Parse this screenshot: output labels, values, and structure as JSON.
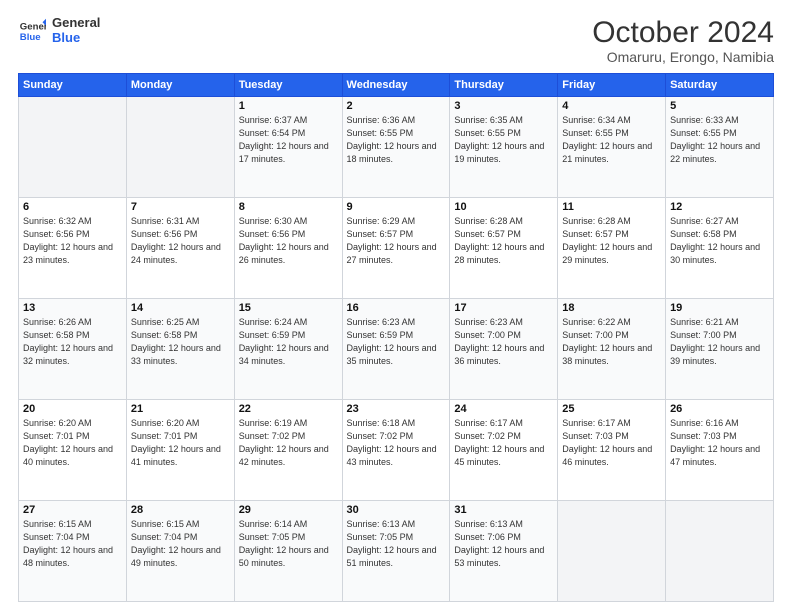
{
  "logo": {
    "line1": "General",
    "line2": "Blue"
  },
  "title": "October 2024",
  "subtitle": "Omaruru, Erongo, Namibia",
  "header_days": [
    "Sunday",
    "Monday",
    "Tuesday",
    "Wednesday",
    "Thursday",
    "Friday",
    "Saturday"
  ],
  "weeks": [
    [
      {
        "day": "",
        "sunrise": "",
        "sunset": "",
        "daylight": ""
      },
      {
        "day": "",
        "sunrise": "",
        "sunset": "",
        "daylight": ""
      },
      {
        "day": "1",
        "sunrise": "Sunrise: 6:37 AM",
        "sunset": "Sunset: 6:54 PM",
        "daylight": "Daylight: 12 hours and 17 minutes."
      },
      {
        "day": "2",
        "sunrise": "Sunrise: 6:36 AM",
        "sunset": "Sunset: 6:55 PM",
        "daylight": "Daylight: 12 hours and 18 minutes."
      },
      {
        "day": "3",
        "sunrise": "Sunrise: 6:35 AM",
        "sunset": "Sunset: 6:55 PM",
        "daylight": "Daylight: 12 hours and 19 minutes."
      },
      {
        "day": "4",
        "sunrise": "Sunrise: 6:34 AM",
        "sunset": "Sunset: 6:55 PM",
        "daylight": "Daylight: 12 hours and 21 minutes."
      },
      {
        "day": "5",
        "sunrise": "Sunrise: 6:33 AM",
        "sunset": "Sunset: 6:55 PM",
        "daylight": "Daylight: 12 hours and 22 minutes."
      }
    ],
    [
      {
        "day": "6",
        "sunrise": "Sunrise: 6:32 AM",
        "sunset": "Sunset: 6:56 PM",
        "daylight": "Daylight: 12 hours and 23 minutes."
      },
      {
        "day": "7",
        "sunrise": "Sunrise: 6:31 AM",
        "sunset": "Sunset: 6:56 PM",
        "daylight": "Daylight: 12 hours and 24 minutes."
      },
      {
        "day": "8",
        "sunrise": "Sunrise: 6:30 AM",
        "sunset": "Sunset: 6:56 PM",
        "daylight": "Daylight: 12 hours and 26 minutes."
      },
      {
        "day": "9",
        "sunrise": "Sunrise: 6:29 AM",
        "sunset": "Sunset: 6:57 PM",
        "daylight": "Daylight: 12 hours and 27 minutes."
      },
      {
        "day": "10",
        "sunrise": "Sunrise: 6:28 AM",
        "sunset": "Sunset: 6:57 PM",
        "daylight": "Daylight: 12 hours and 28 minutes."
      },
      {
        "day": "11",
        "sunrise": "Sunrise: 6:28 AM",
        "sunset": "Sunset: 6:57 PM",
        "daylight": "Daylight: 12 hours and 29 minutes."
      },
      {
        "day": "12",
        "sunrise": "Sunrise: 6:27 AM",
        "sunset": "Sunset: 6:58 PM",
        "daylight": "Daylight: 12 hours and 30 minutes."
      }
    ],
    [
      {
        "day": "13",
        "sunrise": "Sunrise: 6:26 AM",
        "sunset": "Sunset: 6:58 PM",
        "daylight": "Daylight: 12 hours and 32 minutes."
      },
      {
        "day": "14",
        "sunrise": "Sunrise: 6:25 AM",
        "sunset": "Sunset: 6:58 PM",
        "daylight": "Daylight: 12 hours and 33 minutes."
      },
      {
        "day": "15",
        "sunrise": "Sunrise: 6:24 AM",
        "sunset": "Sunset: 6:59 PM",
        "daylight": "Daylight: 12 hours and 34 minutes."
      },
      {
        "day": "16",
        "sunrise": "Sunrise: 6:23 AM",
        "sunset": "Sunset: 6:59 PM",
        "daylight": "Daylight: 12 hours and 35 minutes."
      },
      {
        "day": "17",
        "sunrise": "Sunrise: 6:23 AM",
        "sunset": "Sunset: 7:00 PM",
        "daylight": "Daylight: 12 hours and 36 minutes."
      },
      {
        "day": "18",
        "sunrise": "Sunrise: 6:22 AM",
        "sunset": "Sunset: 7:00 PM",
        "daylight": "Daylight: 12 hours and 38 minutes."
      },
      {
        "day": "19",
        "sunrise": "Sunrise: 6:21 AM",
        "sunset": "Sunset: 7:00 PM",
        "daylight": "Daylight: 12 hours and 39 minutes."
      }
    ],
    [
      {
        "day": "20",
        "sunrise": "Sunrise: 6:20 AM",
        "sunset": "Sunset: 7:01 PM",
        "daylight": "Daylight: 12 hours and 40 minutes."
      },
      {
        "day": "21",
        "sunrise": "Sunrise: 6:20 AM",
        "sunset": "Sunset: 7:01 PM",
        "daylight": "Daylight: 12 hours and 41 minutes."
      },
      {
        "day": "22",
        "sunrise": "Sunrise: 6:19 AM",
        "sunset": "Sunset: 7:02 PM",
        "daylight": "Daylight: 12 hours and 42 minutes."
      },
      {
        "day": "23",
        "sunrise": "Sunrise: 6:18 AM",
        "sunset": "Sunset: 7:02 PM",
        "daylight": "Daylight: 12 hours and 43 minutes."
      },
      {
        "day": "24",
        "sunrise": "Sunrise: 6:17 AM",
        "sunset": "Sunset: 7:02 PM",
        "daylight": "Daylight: 12 hours and 45 minutes."
      },
      {
        "day": "25",
        "sunrise": "Sunrise: 6:17 AM",
        "sunset": "Sunset: 7:03 PM",
        "daylight": "Daylight: 12 hours and 46 minutes."
      },
      {
        "day": "26",
        "sunrise": "Sunrise: 6:16 AM",
        "sunset": "Sunset: 7:03 PM",
        "daylight": "Daylight: 12 hours and 47 minutes."
      }
    ],
    [
      {
        "day": "27",
        "sunrise": "Sunrise: 6:15 AM",
        "sunset": "Sunset: 7:04 PM",
        "daylight": "Daylight: 12 hours and 48 minutes."
      },
      {
        "day": "28",
        "sunrise": "Sunrise: 6:15 AM",
        "sunset": "Sunset: 7:04 PM",
        "daylight": "Daylight: 12 hours and 49 minutes."
      },
      {
        "day": "29",
        "sunrise": "Sunrise: 6:14 AM",
        "sunset": "Sunset: 7:05 PM",
        "daylight": "Daylight: 12 hours and 50 minutes."
      },
      {
        "day": "30",
        "sunrise": "Sunrise: 6:13 AM",
        "sunset": "Sunset: 7:05 PM",
        "daylight": "Daylight: 12 hours and 51 minutes."
      },
      {
        "day": "31",
        "sunrise": "Sunrise: 6:13 AM",
        "sunset": "Sunset: 7:06 PM",
        "daylight": "Daylight: 12 hours and 53 minutes."
      },
      {
        "day": "",
        "sunrise": "",
        "sunset": "",
        "daylight": ""
      },
      {
        "day": "",
        "sunrise": "",
        "sunset": "",
        "daylight": ""
      }
    ]
  ]
}
